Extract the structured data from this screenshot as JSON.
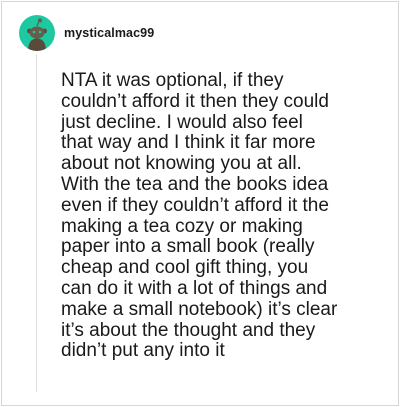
{
  "comment": {
    "username": "mysticalmac99",
    "avatar_icon": "reddit-snoo-avatar-icon",
    "avatar_color": "#1ec8a0",
    "text": "NTA it was optional, if they\ncouldn’t afford it then they could\njust decline. I would also feel\nthat way and I think it far more\nabout not knowing you at all.\nWith the tea and the books idea\neven if they couldn’t afford it the\nmaking a tea cozy or making\npaper into a small book (really\ncheap and cool gift thing, you\ncan do it with a lot of things and\nmake a small notebook) it’s clear\nit’s about the thought and they\ndidn’t put any into it"
  }
}
